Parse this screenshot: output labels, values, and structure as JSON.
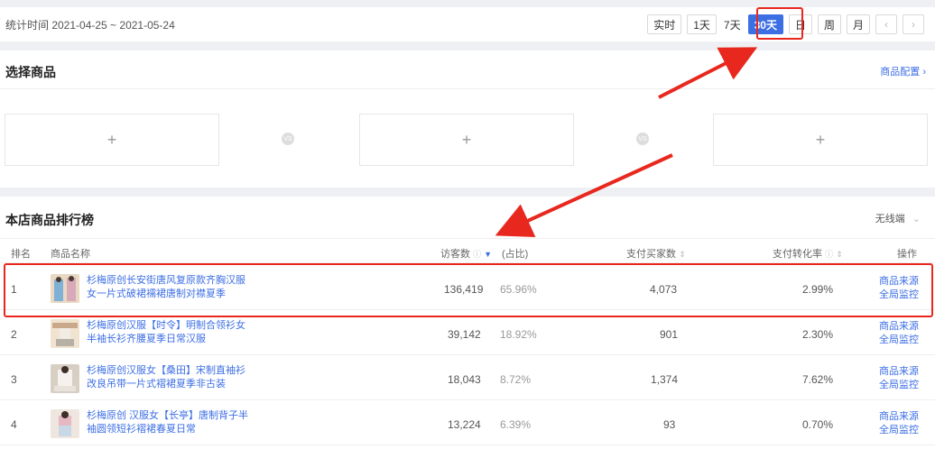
{
  "datebar": {
    "range_text": "统计时间 2021-04-25 ~ 2021-05-24",
    "periods": [
      "实时",
      "1天",
      "7天",
      "30天",
      "日",
      "周",
      "月"
    ],
    "prev_icon": "chevron-left-icon",
    "next_icon": "chevron-right-icon"
  },
  "select_products": {
    "title": "选择商品",
    "config_link": "商品配置",
    "slot_icon": "+",
    "vs_label": "VS"
  },
  "ranking": {
    "title": "本店商品排行榜",
    "device_filter": "无线端",
    "columns": {
      "rank": "排名",
      "name": "商品名称",
      "visitors": "访客数",
      "share": "(占比)",
      "buyers": "支付买家数",
      "conversion": "支付转化率",
      "actions": "操作"
    },
    "rows": [
      {
        "rank": "1",
        "name": "杉梅原创长安街唐风复原款齐胸汉服女一片式破裙襦裙唐制对襟夏季",
        "visitors": "136,419",
        "share": "65.96%",
        "buyers": "4,073",
        "conversion": "2.99%",
        "action1": "商品来源",
        "action2": "全局监控"
      },
      {
        "rank": "2",
        "name": "杉梅原创汉服【时令】明制合领衫女半袖长衫齐腰夏季日常汉服",
        "visitors": "39,142",
        "share": "18.92%",
        "buyers": "901",
        "conversion": "2.30%",
        "action1": "商品来源",
        "action2": "全局监控"
      },
      {
        "rank": "3",
        "name": "杉梅原创汉服女【桑田】宋制直袖衫改良吊带一片式褶裙夏季非古装",
        "visitors": "18,043",
        "share": "8.72%",
        "buyers": "1,374",
        "conversion": "7.62%",
        "action1": "商品来源",
        "action2": "全局监控"
      },
      {
        "rank": "4",
        "name": "杉梅原创 汉服女【长亭】唐制背子半袖圆领短衫褶裙春夏日常",
        "visitors": "13,224",
        "share": "6.39%",
        "buyers": "93",
        "conversion": "0.70%",
        "action1": "商品来源",
        "action2": "全局监控"
      }
    ]
  },
  "colors": {
    "accent": "#3d6fe4",
    "highlight": "#e8281e"
  }
}
